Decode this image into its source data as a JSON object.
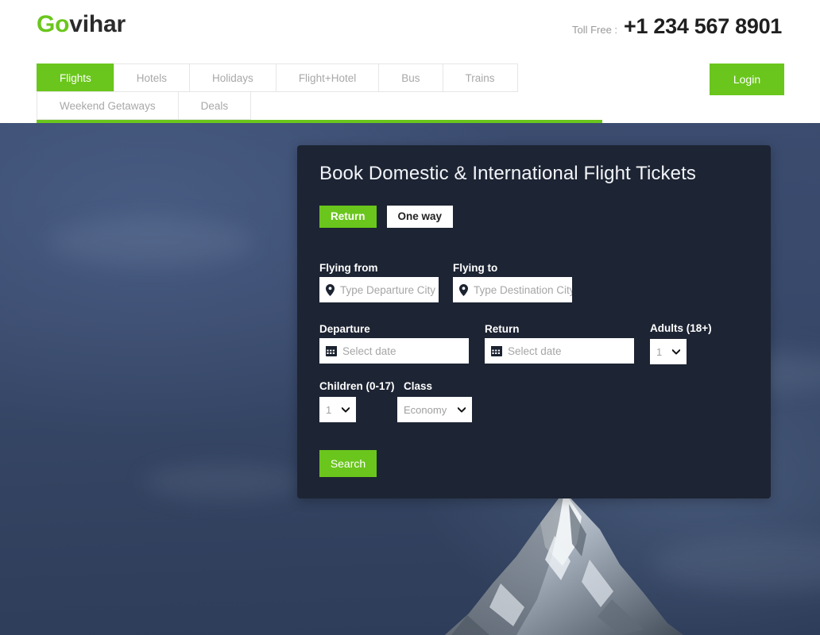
{
  "brand": {
    "prefix": "Go",
    "suffix": "vihar"
  },
  "contact": {
    "label": "Toll Free :",
    "number": "+1 234 567 8901"
  },
  "nav": {
    "tabs": [
      {
        "label": "Flights",
        "active": true
      },
      {
        "label": "Hotels",
        "active": false
      },
      {
        "label": "Holidays",
        "active": false
      },
      {
        "label": "Flight+Hotel",
        "active": false
      },
      {
        "label": "Bus",
        "active": false
      },
      {
        "label": "Trains",
        "active": false
      },
      {
        "label": "Weekend Getaways",
        "active": false
      },
      {
        "label": "Deals",
        "active": false
      }
    ],
    "login_label": "Login"
  },
  "booking": {
    "title": "Book Domestic & International Flight Tickets",
    "trip_return": "Return",
    "trip_oneway": "One way",
    "flying_from_label": "Flying from",
    "flying_from_placeholder": "Type Departure City",
    "flying_from_value": "",
    "flying_to_label": "Flying to",
    "flying_to_placeholder": "Type Destination City",
    "flying_to_value": "",
    "departure_label": "Departure",
    "departure_placeholder": "Select date",
    "departure_value": "",
    "return_label": "Return",
    "return_placeholder": "Select date",
    "return_value": "",
    "adults_label": "Adults (18+)",
    "adults_value": "1",
    "children_label": "Children (0-17)",
    "children_value": "1",
    "class_label": "Class",
    "class_value": "Economy",
    "search_label": "Search"
  },
  "colors": {
    "accent_green": "#6ac61c",
    "panel_dark": "#1d2433",
    "sky_blue": "#3b4c70",
    "text_dark": "#1f1f1f",
    "muted_gray": "#a8a8a8"
  },
  "icons": {
    "map_pin": "map-pin-icon",
    "calendar": "calendar-icon",
    "chevron_down": "chevron-down-icon"
  }
}
